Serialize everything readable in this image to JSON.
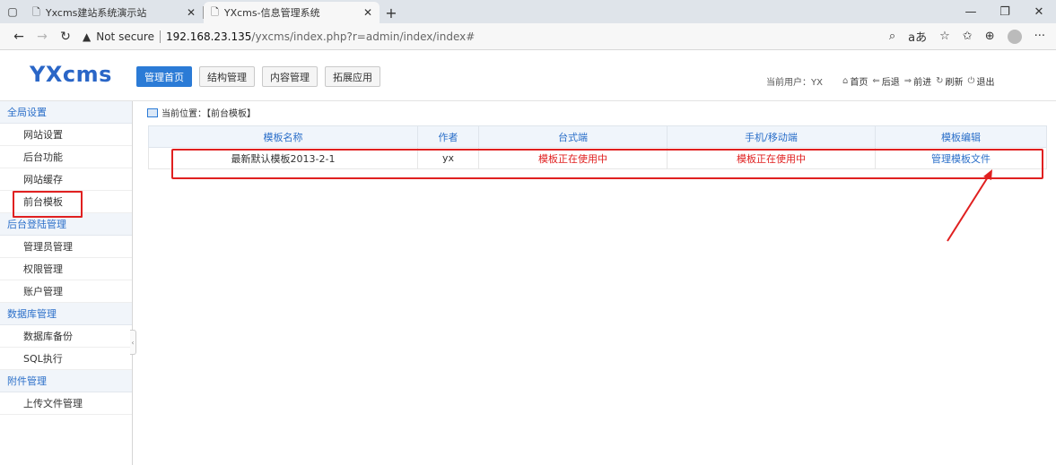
{
  "browser": {
    "tabs": [
      {
        "title": "Yxcms建站系统演示站",
        "active": false
      },
      {
        "title": "YXcms-信息管理系统",
        "active": true
      }
    ],
    "address": {
      "security_label": "Not secure",
      "host": "192.168.23.135",
      "path": "/yxcms/index.php?r=admin/index/index#"
    }
  },
  "header": {
    "logo": "YXcms",
    "nav": [
      {
        "label": "管理首页",
        "active": true
      },
      {
        "label": "结构管理",
        "active": false
      },
      {
        "label": "内容管理",
        "active": false
      },
      {
        "label": "拓展应用",
        "active": false
      }
    ],
    "current_user": "当前用户：YX",
    "quick_links": [
      {
        "icon": "⌂",
        "label": "首页"
      },
      {
        "icon": "⇐",
        "label": "后退"
      },
      {
        "icon": "⇒",
        "label": "前进"
      },
      {
        "icon": "↻",
        "label": "刷新"
      },
      {
        "icon": "⏻",
        "label": "退出"
      }
    ]
  },
  "sidebar": {
    "groups": [
      {
        "title": "全局设置",
        "items": [
          "网站设置",
          "后台功能",
          "网站缓存",
          "前台模板"
        ]
      },
      {
        "title": "后台登陆管理",
        "items": [
          "管理员管理",
          "权限管理",
          "账户管理"
        ]
      },
      {
        "title": "数据库管理",
        "items": [
          "数据库备份",
          "SQL执行"
        ]
      },
      {
        "title": "附件管理",
        "items": [
          "上传文件管理"
        ]
      }
    ],
    "selected": "前台模板"
  },
  "main": {
    "breadcrumb": "当前位置：【前台模板】",
    "table": {
      "headers": [
        "模板名称",
        "作者",
        "台式端",
        "手机/移动端",
        "模板编辑"
      ],
      "rows": [
        {
          "name": "最新默认模板2013-2-1",
          "author": "yx",
          "desktop": "模板正在使用中",
          "mobile": "模板正在使用中",
          "edit": "管理模板文件"
        }
      ]
    }
  },
  "colors": {
    "accent": "#2b7bd6",
    "highlight": "#e02020",
    "logo": "#2a66c7"
  }
}
